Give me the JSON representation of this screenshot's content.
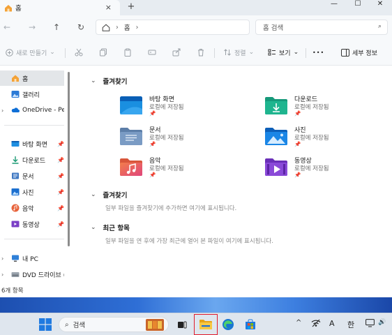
{
  "window": {
    "tab_title": "홈",
    "tab_close": "×",
    "new_tab": "+",
    "controls": {
      "minimize": "—",
      "maximize": "☐",
      "close": "✕"
    }
  },
  "nav": {
    "back": "←",
    "forward": "→",
    "up": "↑",
    "refresh": "↻",
    "address": {
      "home_icon": "home-icon",
      "sep1": "›",
      "segment": "홈",
      "sep2": "›"
    },
    "search_placeholder": "홈 검색",
    "search_icon": "⌕"
  },
  "commandbar": {
    "new_label": "새로 만들기",
    "new_caret": "⌄",
    "sort_label": "정렬",
    "sort_caret": "⌄",
    "view_label": "보기",
    "view_caret": "⌄",
    "more": "•••",
    "details_label": "세부 정보"
  },
  "sidebar": {
    "items": [
      {
        "label": "홈",
        "icon": "home-icon",
        "active": true
      },
      {
        "label": "갤러리",
        "icon": "gallery-icon"
      },
      {
        "label": "OneDrive - Pers",
        "icon": "onedrive-icon",
        "chevron": "›"
      },
      {
        "label": "바탕 화면",
        "icon": "desktop-icon",
        "pin": "📌"
      },
      {
        "label": "다운로드",
        "icon": "download-icon",
        "pin": "📌"
      },
      {
        "label": "문서",
        "icon": "document-icon",
        "pin": "📌"
      },
      {
        "label": "사진",
        "icon": "picture-icon",
        "pin": "📌"
      },
      {
        "label": "음악",
        "icon": "music-icon",
        "pin": "📌"
      },
      {
        "label": "동영상",
        "icon": "video-icon",
        "pin": "📌"
      },
      {
        "label": "내 PC",
        "icon": "pc-icon",
        "chevron": "›"
      },
      {
        "label": "DVD 드라이브 (",
        "icon": "dvd-icon",
        "chevron": "›"
      }
    ]
  },
  "main": {
    "quick_access_title": "즐겨찾기",
    "quick_items": [
      {
        "name": "바탕 화면",
        "sub": "로컬에 저장됨",
        "pin": "📌",
        "icon": "desktop-folder-icon"
      },
      {
        "name": "다운로드",
        "sub": "로컬에 저장됨",
        "pin": "📌",
        "icon": "download-folder-icon"
      },
      {
        "name": "문서",
        "sub": "로컬에 저장됨",
        "pin": "📌",
        "icon": "document-folder-icon"
      },
      {
        "name": "사진",
        "sub": "로컬에 저장됨",
        "pin": "📌",
        "icon": "picture-folder-icon"
      },
      {
        "name": "음악",
        "sub": "로컬에 저장됨",
        "pin": "📌",
        "icon": "music-folder-icon"
      },
      {
        "name": "동영상",
        "sub": "로컬에 저장됨",
        "pin": "📌",
        "icon": "video-folder-icon"
      }
    ],
    "favorites_title": "즐겨찾기",
    "favorites_empty": "일부 파일을 즐겨찾기에 추가하면 여기에 표시됩니다.",
    "recent_title": "최근 항목",
    "recent_empty": "일부 파일을 연 후에 가장 최근에 열어 본 파일이 여기에 표시됩니다."
  },
  "status": {
    "count": "6개 항목"
  },
  "taskbar": {
    "search_label": "검색",
    "search_icon": "⌕",
    "tray": {
      "chevron": "^",
      "ime_a": "A",
      "ime_han": "한",
      "volume": "🔊"
    }
  },
  "colors": {
    "accent_red": "#e0192b",
    "folder_blue": "#1a8fe0",
    "folder_teal": "#1fa789"
  }
}
